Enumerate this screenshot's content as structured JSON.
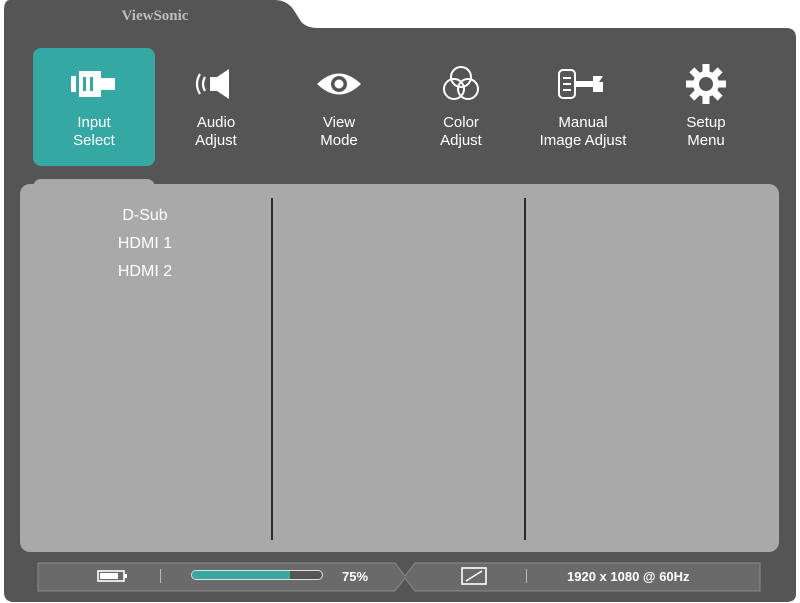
{
  "brand": "ViewSonic",
  "menu": {
    "tabs": [
      {
        "label": "Input\nSelect",
        "icon": "input-select-icon",
        "active": true
      },
      {
        "label": "Audio\nAdjust",
        "icon": "speaker-icon",
        "active": false
      },
      {
        "label": "View\nMode",
        "icon": "eye-icon",
        "active": false
      },
      {
        "label": "Color\nAdjust",
        "icon": "color-circles-icon",
        "active": false
      },
      {
        "label": "Manual\nImage Adjust",
        "icon": "hand-wrench-icon",
        "active": false
      },
      {
        "label": "Setup\nMenu",
        "icon": "gear-icon",
        "active": false
      }
    ]
  },
  "input_options": [
    "D-Sub",
    "HDMI 1",
    "HDMI 2"
  ],
  "status_bar": {
    "progress": 0.75,
    "progress_label": "75%",
    "resolution": "1920 x 1080 @ 60Hz"
  },
  "colors": {
    "frame": "#555555",
    "accent": "#36a8a3",
    "content": "#a9a9a9"
  }
}
